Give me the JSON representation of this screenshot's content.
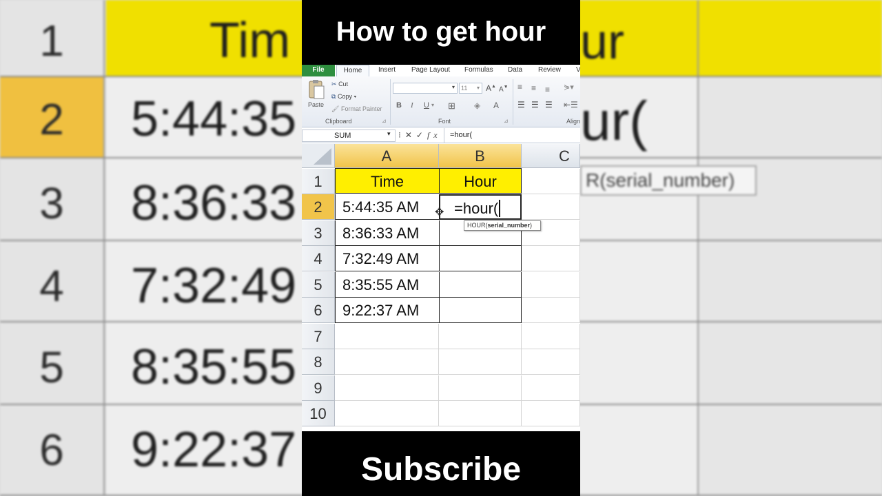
{
  "title": "How to get hour",
  "footer": "Subscribe",
  "ribbon": {
    "tabs": [
      "File",
      "Home",
      "Insert",
      "Page Layout",
      "Formulas",
      "Data",
      "Review",
      "V"
    ],
    "clipboard": {
      "paste": "Paste",
      "cut": "Cut",
      "copy": "Copy",
      "format_painter": "Format Painter",
      "label": "Clipboard"
    },
    "font": {
      "size": "11",
      "bold": "B",
      "italic": "I",
      "underline": "U",
      "label": "Font"
    },
    "alignment": {
      "label": "Align"
    }
  },
  "formula_bar": {
    "name_box": "SUM",
    "value": "=hour("
  },
  "columns": [
    "A",
    "B",
    "C"
  ],
  "rows": [
    "1",
    "2",
    "3",
    "4",
    "5",
    "6",
    "7",
    "8",
    "9",
    "10"
  ],
  "table": {
    "headers": [
      "Time",
      "Hour"
    ],
    "times": [
      "5:44:35 AM",
      "8:36:33 AM",
      "7:32:49 AM",
      "8:35:55 AM",
      "9:22:37 AM"
    ],
    "active_input": "=hour("
  },
  "tooltip": {
    "fn": "HOUR(",
    "arg": "serial_number",
    "close": ")"
  },
  "background": {
    "rows": [
      "1",
      "2",
      "3",
      "4",
      "5",
      "6"
    ],
    "cells": [
      "Tim",
      "5:44:35",
      "8:36:33",
      "7:32:49",
      "8:35:55",
      "9:22:37"
    ],
    "formula_fragment": "ur(",
    "title_fragment": "ur",
    "tip_fragment": "R(serial_number)"
  },
  "colors": {
    "header_fill": "#ffef00",
    "selected_header": "#f1c44a",
    "file_tab": "#2f8f3f"
  }
}
